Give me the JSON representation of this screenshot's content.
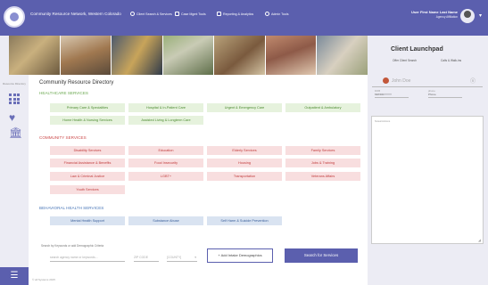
{
  "topnav": {
    "org_title": "Community Resource Network, Western Colorado",
    "items": [
      {
        "label": "Client Search & Services"
      },
      {
        "label": "Case Mgmt Tools"
      },
      {
        "label": "Reporting & Analytics"
      },
      {
        "label": "Admin Tools"
      }
    ],
    "user_name": "User First Name Last Name",
    "user_role": "Agency Affiliation"
  },
  "rail": {
    "label": "Resource Directory"
  },
  "launchpad": {
    "title": "Client Launchpad",
    "links": [
      "Offer Client Search",
      "Calls & Walk-ins"
    ],
    "search_placeholder": "John Doe",
    "dob_label": "DOB",
    "dob_value": "MM/DD/YYYY",
    "phone_label": "phone",
    "phone_value": "Phone",
    "notes_label": "Notes/Actions"
  },
  "directory": {
    "title": "Community Resource Directory",
    "healthcare": {
      "heading": "HEALTHCARE SERVICES",
      "tiles": [
        "Primary Care & Specialities",
        "Hospital & In-Patient Care",
        "Urgent & Emergency Care",
        "Outpatient & Ambulatory",
        "Home Health & Nursing Services",
        "Assisted Living & Longterm Care"
      ]
    },
    "community": {
      "heading": "COMMUNITY SERVICES",
      "tiles": [
        "Disability Services",
        "Education",
        "Elderly Services",
        "Family Services",
        "Financial Assistance & Benefits",
        "Food Insecurity",
        "Housing",
        "Jobs & Training",
        "Law & Criminal Justice",
        "LGBT+",
        "Transportation",
        "Veterans Affairs",
        "Youth Services"
      ]
    },
    "behavioral": {
      "heading": "BEHAVIORAL HEALTH SERVICES",
      "tiles": [
        "Mental Health Support",
        "Substance Abuse",
        "Self Harm & Suicide Prevention"
      ]
    }
  },
  "search_form": {
    "label": "Search by Keywords or add Demographic Criteria",
    "keyword_placeholder": "search agency name or keywords...",
    "zip_placeholder": "ZIP CODE",
    "county_placeholder": "[COUNTY]",
    "county_caret": "▾",
    "add_button": "+ Add Intake Demographics",
    "search_button": "Search for Services"
  },
  "footer": {
    "text": "© all Systems 2015"
  },
  "colors": {
    "primary": "#5b5fae",
    "health": "#6aa84f",
    "community": "#cc4a4a",
    "behavioral": "#4a77b8"
  }
}
